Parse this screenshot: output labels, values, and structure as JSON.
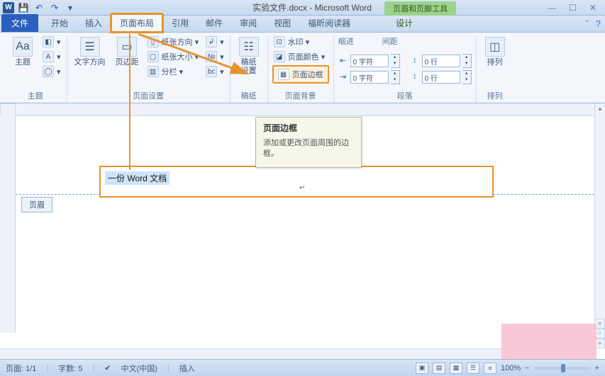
{
  "title": "实验文件.docx - Microsoft Word",
  "context_tab_title": "页眉和页脚工具",
  "context_tab": "设计",
  "file_tab": "文件",
  "tabs": [
    "开始",
    "插入",
    "页面布局",
    "引用",
    "邮件",
    "审阅",
    "视图",
    "福昕阅读器"
  ],
  "groups": {
    "theme": {
      "label": "主题",
      "main": "主题"
    },
    "page_setup": {
      "label": "页面设置",
      "text_dir": "文字方向",
      "margins": "页边距",
      "orientation": "纸张方向 ▾",
      "size": "纸张大小 ▾",
      "columns": "分栏 ▾"
    },
    "manuscript": {
      "label": "稿纸",
      "btn": "稿纸\n设置"
    },
    "page_bg": {
      "label": "页面背景",
      "watermark": "水印 ▾",
      "page_color": "页面颜色 ▾",
      "page_border": "页面边框"
    },
    "paragraph": {
      "label": "段落",
      "indent_label": "缩进",
      "spacing_label": "间距",
      "indent_left": "0 字符",
      "indent_right": "0 字符",
      "space_before": "0 行",
      "space_after": "0 行"
    },
    "arrange": {
      "label": "排列",
      "btn": "排列"
    }
  },
  "tooltip": {
    "title": "页面边框",
    "body": "添加或更改页面周围的边框。"
  },
  "document": {
    "header_text": "一份 Word 文档",
    "header_tag": "页眉"
  },
  "status": {
    "page": "页面: 1/1",
    "words": "字数: 5",
    "lang": "中文(中国)",
    "mode": "插入",
    "zoom": "100%"
  }
}
